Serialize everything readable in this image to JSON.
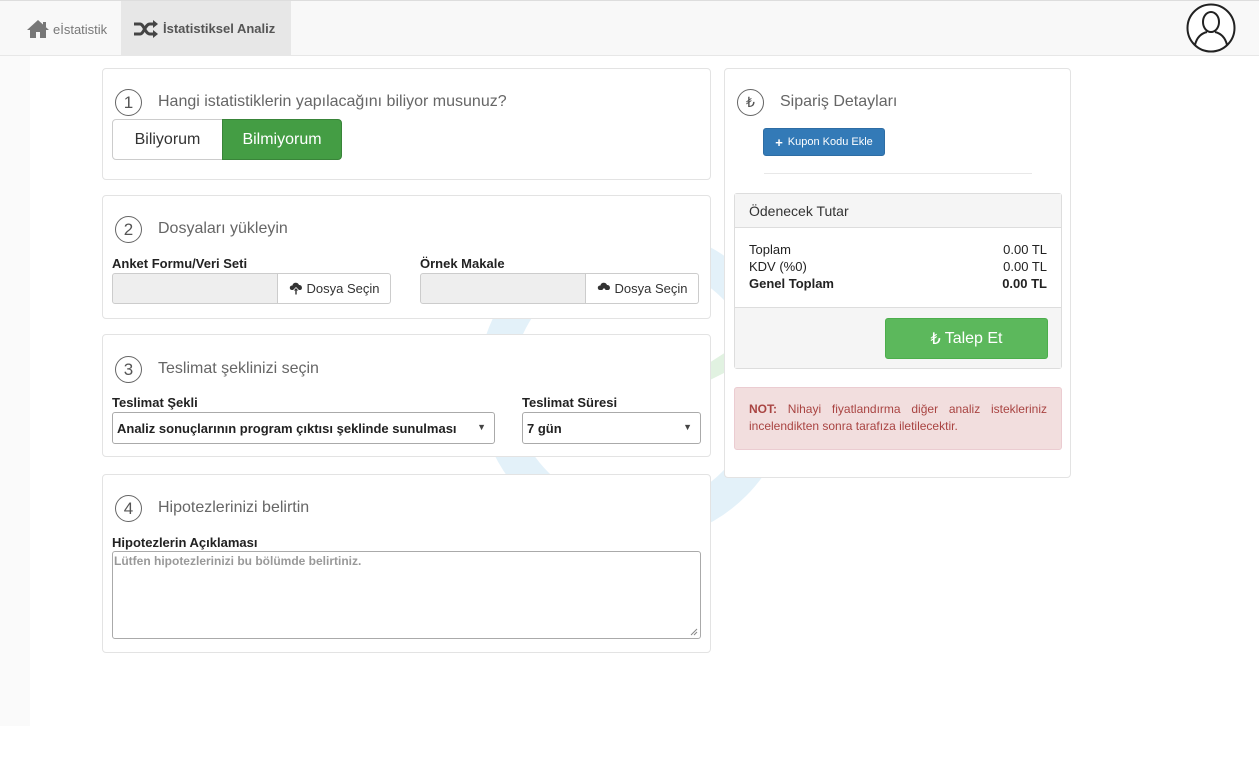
{
  "nav": {
    "home_label": "eİstatistik",
    "active_label": "İstatistiksel Analiz"
  },
  "step1": {
    "number": "1",
    "title": "Hangi istatistiklerin yapılacağını biliyor musunuz?",
    "option_yes": "Biliyorum",
    "option_no": "Bilmiyorum",
    "selected": "Bilmiyorum"
  },
  "step2": {
    "number": "2",
    "title": "Dosyaları yükleyin",
    "field1_label": "Anket Formu/Veri Seti",
    "field2_label": "Örnek Makale",
    "choose_label": "Dosya Seçin"
  },
  "step3": {
    "number": "3",
    "title": "Teslimat şeklinizi seçin",
    "method_label": "Teslimat Şekli",
    "method_value": "Analiz sonuçlarının program çıktısı şeklinde sunulması",
    "duration_label": "Teslimat Süresi",
    "duration_value": "7 gün"
  },
  "step4": {
    "number": "4",
    "title": "Hipotezlerinizi belirtin",
    "desc_label": "Hipotezlerin Açıklaması",
    "placeholder": "Lütfen hipotezlerinizi bu bölümde belirtiniz."
  },
  "order": {
    "currency_icon": "₺",
    "title": "Sipariş Detayları",
    "coupon_label": "Kupon Kodu Ekle",
    "amount_title": "Ödenecek Tutar",
    "rows": [
      {
        "label": "Toplam",
        "value": "0.00 TL"
      },
      {
        "label": "KDV (%0)",
        "value": "0.00 TL"
      },
      {
        "label": "Genel Toplam",
        "value": "0.00 TL"
      }
    ],
    "submit_label": "Talep Et",
    "note_prefix": "NOT:",
    "note_text": "Nihayi fiyatlandırma diğer analiz istekleriniz incelendikten sonra tarafıza iletilecektir."
  },
  "colors": {
    "success": "#449d44",
    "primary": "#337ab7",
    "danger_text": "#a94442"
  }
}
